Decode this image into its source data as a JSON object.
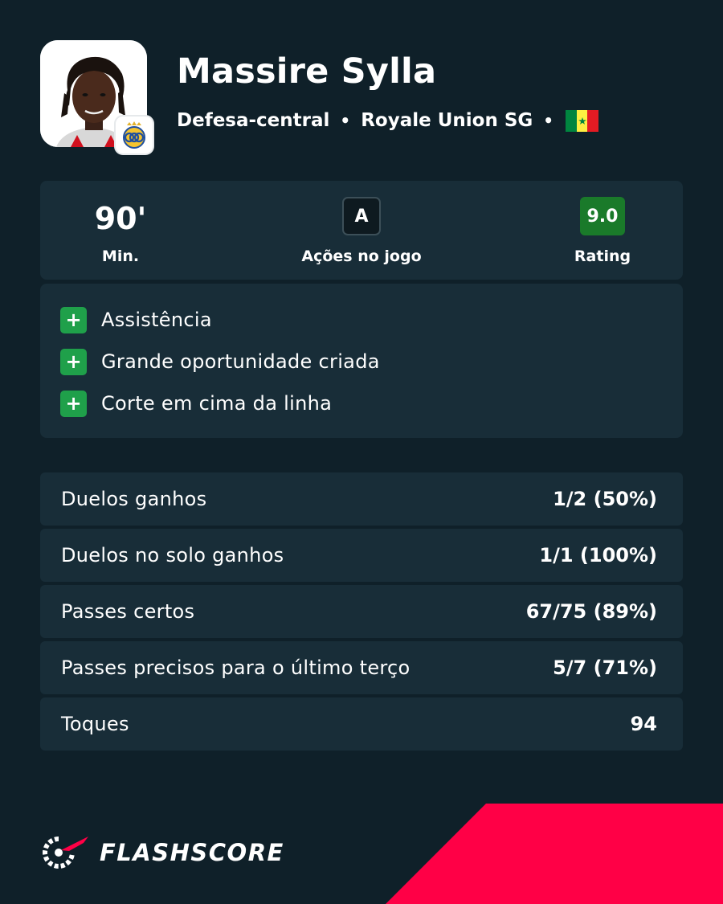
{
  "player": {
    "name": "Massire Sylla",
    "position": "Defesa-central",
    "club": "Royale Union SG",
    "separator": "•",
    "flag_colors": [
      "#00853f",
      "#fdef42",
      "#e31b23"
    ]
  },
  "summary": {
    "minutes": "90'",
    "minutes_label": "Min.",
    "grade": "A",
    "grade_label": "Ações no jogo",
    "rating": "9.0",
    "rating_label": "Rating",
    "rating_color": "#1a7a2a"
  },
  "actions": [
    {
      "icon": "plus-icon",
      "label": "Assistência"
    },
    {
      "icon": "plus-icon",
      "label": "Grande oportunidade criada"
    },
    {
      "icon": "plus-icon",
      "label": "Corte em cima da linha"
    }
  ],
  "stats": [
    {
      "label": "Duelos ganhos",
      "value": "1/2 (50%)"
    },
    {
      "label": "Duelos no solo ganhos",
      "value": "1/1 (100%)"
    },
    {
      "label": "Passes certos",
      "value": "67/75 (89%)"
    },
    {
      "label": "Passes precisos para o último terço",
      "value": "5/7 (71%)"
    },
    {
      "label": "Toques",
      "value": "94"
    }
  ],
  "brand": {
    "name": "FLASHSCORE",
    "accent": "#ff0046"
  },
  "colors": {
    "background": "#0f2029",
    "card": "#182d38",
    "plus_badge": "#1fa04a"
  }
}
